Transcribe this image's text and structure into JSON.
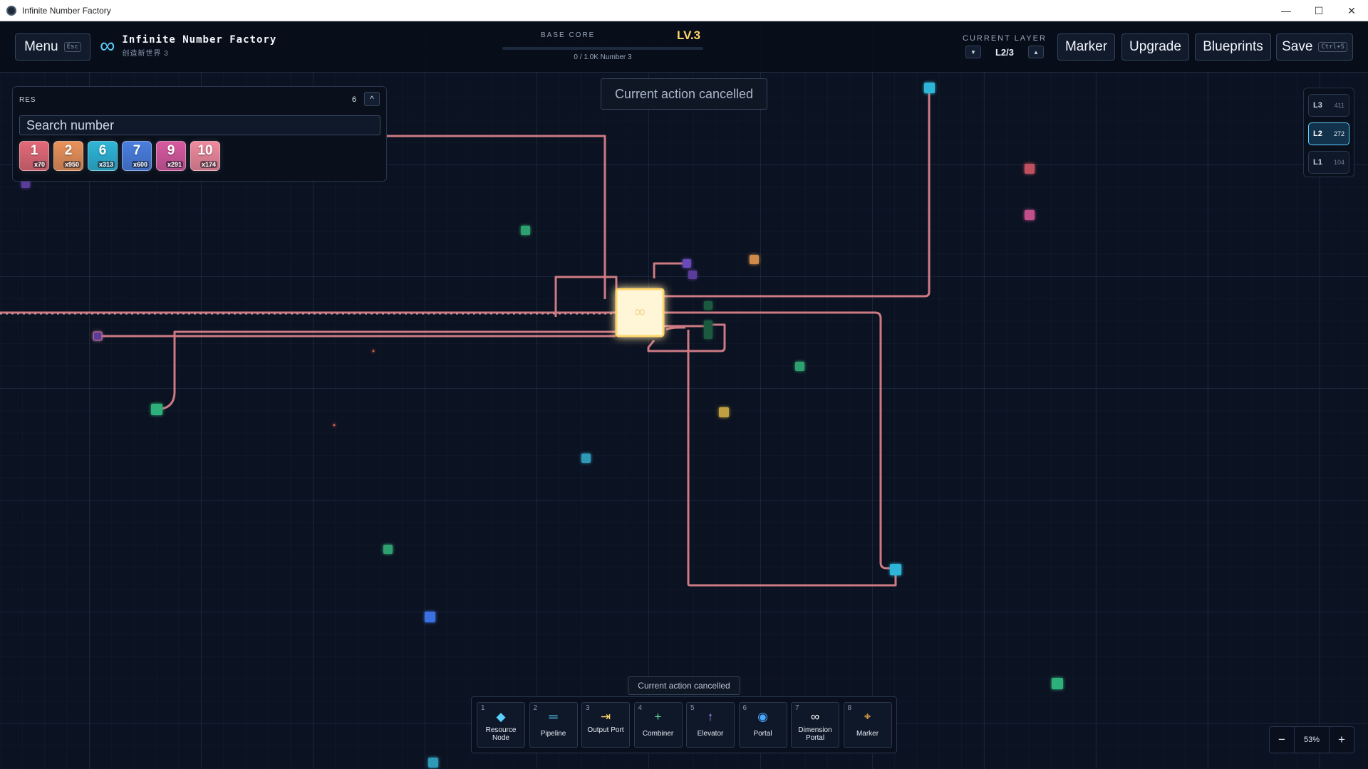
{
  "window": {
    "title": "Infinite Number Factory",
    "min_glyph": "—",
    "max_glyph": "☐",
    "close_glyph": "✕"
  },
  "header": {
    "menu_label": "Menu",
    "menu_key": "Esc",
    "brand_icon": "infinity-icon",
    "brand_glyph": "∞",
    "brand_name": "Infinite Number Factory",
    "world_name": "创造新世界 3",
    "core_label": "BASE CORE",
    "core_level": "LV.3",
    "core_progress_text": "0 / 1.0K Number 3",
    "core_progress_fraction": 0,
    "layer_label": "CURRENT LAYER",
    "layer_value": "L2/3",
    "layer_down_glyph": "▼",
    "layer_up_glyph": "▲",
    "marker_label": "Marker",
    "upgrade_label": "Upgrade",
    "blueprints_label": "Blueprints",
    "save_label": "Save",
    "save_key": "Ctrl+S"
  },
  "toast": "Current action cancelled",
  "resources": {
    "title": "RES",
    "count": "6",
    "collapse_glyph": "^",
    "search_placeholder": "Search number",
    "items": [
      {
        "number": "1",
        "qty": "x70",
        "color": "#e46a78"
      },
      {
        "number": "2",
        "qty": "x950",
        "color": "#e9925a"
      },
      {
        "number": "6",
        "qty": "x313",
        "color": "#2fb6d8"
      },
      {
        "number": "7",
        "qty": "x600",
        "color": "#4a7fe0"
      },
      {
        "number": "9",
        "qty": "x291",
        "color": "#d85aa0"
      },
      {
        "number": "10",
        "qty": "x174",
        "color": "#f08a9e"
      }
    ]
  },
  "layers": [
    {
      "name": "L3",
      "count": "411",
      "active": false
    },
    {
      "name": "L2",
      "count": "272",
      "active": true
    },
    {
      "name": "L1",
      "count": "104",
      "active": false
    }
  ],
  "hint": "Current action cancelled",
  "tools": [
    {
      "key": "1",
      "label": "Resource Node",
      "icon": "diamond-icon",
      "glyph": "◆",
      "color": "#5ad0ff"
    },
    {
      "key": "2",
      "label": "Pipeline",
      "icon": "pipeline-icon",
      "glyph": "═",
      "color": "#5ad0ff"
    },
    {
      "key": "3",
      "label": "Output Port",
      "icon": "output-port-icon",
      "glyph": "⇥",
      "color": "#ffd56a"
    },
    {
      "key": "4",
      "label": "Combiner",
      "icon": "plus-icon",
      "glyph": "+",
      "color": "#5be0a0"
    },
    {
      "key": "5",
      "label": "Elevator",
      "icon": "elevator-arrow-icon",
      "glyph": "↑",
      "color": "#b08cff"
    },
    {
      "key": "6",
      "label": "Portal",
      "icon": "portal-icon",
      "glyph": "◉",
      "color": "#4aa8ff"
    },
    {
      "key": "7",
      "label": "Dimension Portal",
      "icon": "infinity-icon",
      "glyph": "∞",
      "color": "#ffffff"
    },
    {
      "key": "8",
      "label": "Marker",
      "icon": "marker-icon",
      "glyph": "⌖",
      "color": "#ffb84a"
    }
  ],
  "zoom": {
    "minus_glyph": "−",
    "plus_glyph": "+",
    "value": "53%"
  }
}
